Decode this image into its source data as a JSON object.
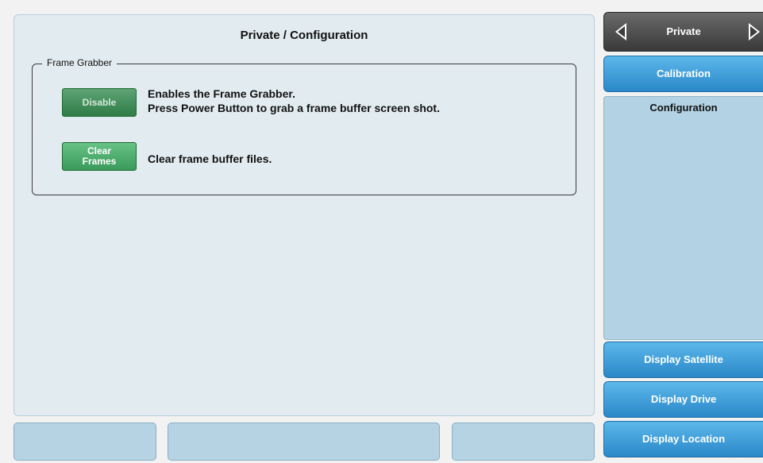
{
  "header": {
    "title": "Private / Configuration"
  },
  "frame_grabber": {
    "legend": "Frame Grabber",
    "disable_button": {
      "line1": "Disable",
      "line2": ""
    },
    "disable_desc_line1": "Enables the Frame Grabber.",
    "disable_desc_line2": "Press Power Button to grab a frame buffer screen shot.",
    "clear_button": {
      "line1": "Clear",
      "line2": "Frames"
    },
    "clear_desc": "Clear frame buffer files."
  },
  "sidebar": {
    "nav_label": "Private",
    "calibration": "Calibration",
    "list_item": "Configuration",
    "display_satellite": "Display Satellite",
    "display_drive": "Display Drive",
    "display_location": "Display Location"
  },
  "colors": {
    "panel_bg": "#e2ecf0",
    "button_green": "#3a9a5b",
    "sidebar_blue": "#2a88c8",
    "sidebar_list": "#b3d2e3"
  }
}
